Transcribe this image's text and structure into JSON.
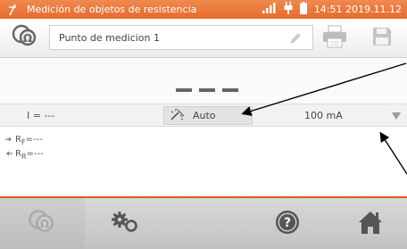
{
  "status_bar": {
    "title": "Medición de objetos de resistencia",
    "time": "14:51 2019.11.12",
    "accent_color": "#e66b2e",
    "icons": [
      "measurement-icon",
      "signal-icon",
      "plug-icon",
      "battery-icon"
    ]
  },
  "header": {
    "point_name": "Punto de medicion 1",
    "icons": [
      "resistance-mode-icon",
      "pencil-icon",
      "printer-icon",
      "save-icon"
    ]
  },
  "result": {
    "value": "- - -"
  },
  "params": {
    "current_label": "I = ---",
    "auto_label": "Auto",
    "range_value": "100 mA"
  },
  "readings": {
    "rf_label": "R",
    "rf_sub": "F",
    "rf_value": "=---",
    "rr_label": "R",
    "rr_sub": "R",
    "rr_value": "=---"
  },
  "toolbar": {
    "buttons": [
      "resistance-mode-icon",
      "settings-icon",
      "help-icon",
      "home-icon"
    ],
    "selected_tab_color": "#e05a1a"
  }
}
